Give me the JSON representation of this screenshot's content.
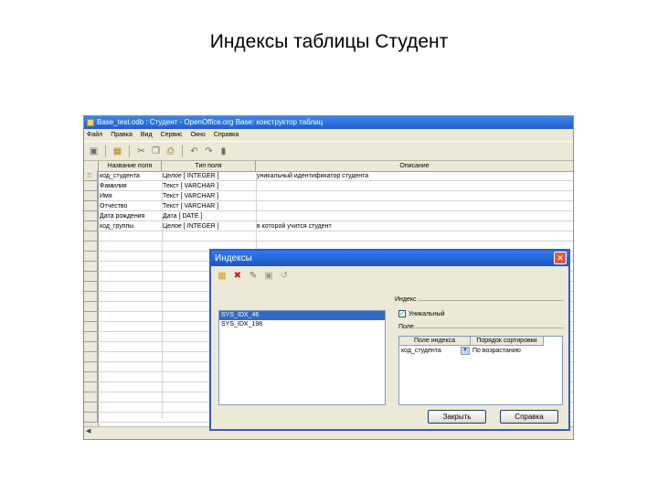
{
  "slide": {
    "title": "Индексы таблицы Студент"
  },
  "window": {
    "title": "Base_test.odb : Студент - OpenOffice.org Base: конструктор таблиц",
    "menu": [
      "Файл",
      "Правка",
      "Вид",
      "Сервис",
      "Окно",
      "Справка"
    ]
  },
  "grid": {
    "headers": {
      "name": "Название поля",
      "type": "Тип поля",
      "desc": "Описание"
    },
    "rows": [
      {
        "name": "код_студента",
        "type": "Целое [ INTEGER ]",
        "desc": "уникальный идентификатор студента",
        "key": true
      },
      {
        "name": "Фамилия",
        "type": "Текст [ VARCHAR ]",
        "desc": ""
      },
      {
        "name": "Имя",
        "type": "Текст [ VARCHAR ]",
        "desc": ""
      },
      {
        "name": "Отчество",
        "type": "Текст [ VARCHAR ]",
        "desc": ""
      },
      {
        "name": "Дата рождения",
        "type": "Дата [ DATE ]",
        "desc": ""
      },
      {
        "name": "код_группы",
        "type": "Целое [ INTEGER ]",
        "desc": "в которой учится студент"
      }
    ]
  },
  "dialog": {
    "title": "Индексы",
    "close_glyph": "✕",
    "indexes": [
      "SYS_IDX_46",
      "SYS_IDX_198"
    ],
    "selected_index": 0,
    "index_group_label": "Индекс",
    "unique_label": "Уникальный",
    "unique_checked": true,
    "fields_group_label": "Поле",
    "fields_headers": {
      "field": "Поле индекса",
      "sort": "Порядок сортировки"
    },
    "fields_rows": [
      {
        "field": "код_студента",
        "sort": "По возрастанию"
      }
    ],
    "close_button": "Закрыть",
    "help_button": "Справка"
  }
}
